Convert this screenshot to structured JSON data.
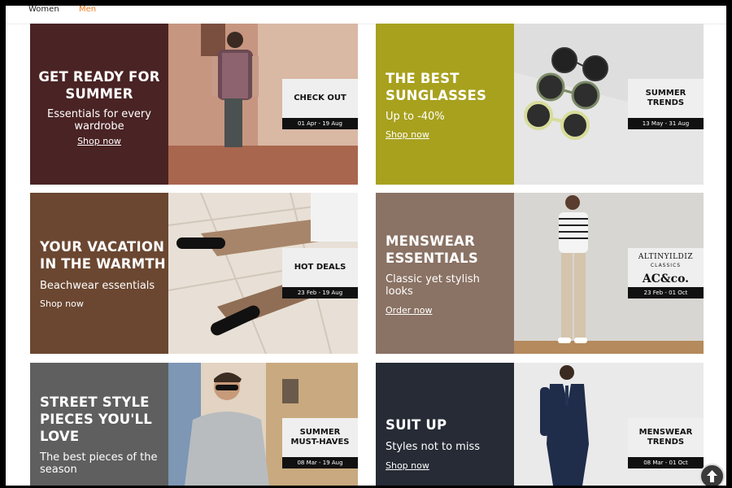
{
  "tabs": [
    {
      "label": "Women"
    },
    {
      "label": "Men",
      "active": true
    }
  ],
  "colors": {
    "accent": "#f27a1a",
    "card1_panel": "#4a2324",
    "card2_panel": "#a8a11e",
    "card3_panel": "#6b4731",
    "card4_panel": "#8a7264",
    "card5_panel": "#5f5f5f",
    "card6_panel": "#262b35"
  },
  "cards": [
    {
      "title": "GET READY FOR SUMMER",
      "subtitle": "Essentials for every wardrobe",
      "link": "Shop now",
      "tag_label": "CHECK OUT",
      "tag_date": "01 Apr - 19 Aug"
    },
    {
      "title": "THE BEST SUNGLASSES",
      "subtitle": "Up to -40%",
      "link": "Shop now",
      "tag_label": "SUMMER TRENDS",
      "tag_date": "13 May - 31 Aug"
    },
    {
      "title": "YOUR VACATION IN THE WARMTH",
      "subtitle": "Beachwear essentials",
      "link": "Shop now",
      "tag_label": "HOT DEALS",
      "tag_date": "23 Feb - 19 Aug"
    },
    {
      "title": "MENSWEAR ESSENTIALS",
      "subtitle": "Classic yet stylish looks",
      "link": "Order now",
      "tag_brand_1": "ALTINYILDIZ",
      "tag_brand_1_sub": "CLASSICS",
      "tag_brand_2": "AC&co.",
      "tag_date": "23 Feb - 01 Oct"
    },
    {
      "title": "STREET STYLE PIECES YOU'LL LOVE",
      "subtitle": "The best pieces of the season",
      "link": "Shop now",
      "tag_label": "SUMMER MUST-HAVES",
      "tag_date": "08 Mar - 19 Aug"
    },
    {
      "title": "SUIT UP",
      "subtitle": "Styles not to miss",
      "link": "Shop now",
      "tag_label": "MENSWEAR TRENDS",
      "tag_date": "08 Mar - 01 Oct"
    }
  ],
  "icons": {
    "scroll_top": "arrow-up-icon"
  }
}
